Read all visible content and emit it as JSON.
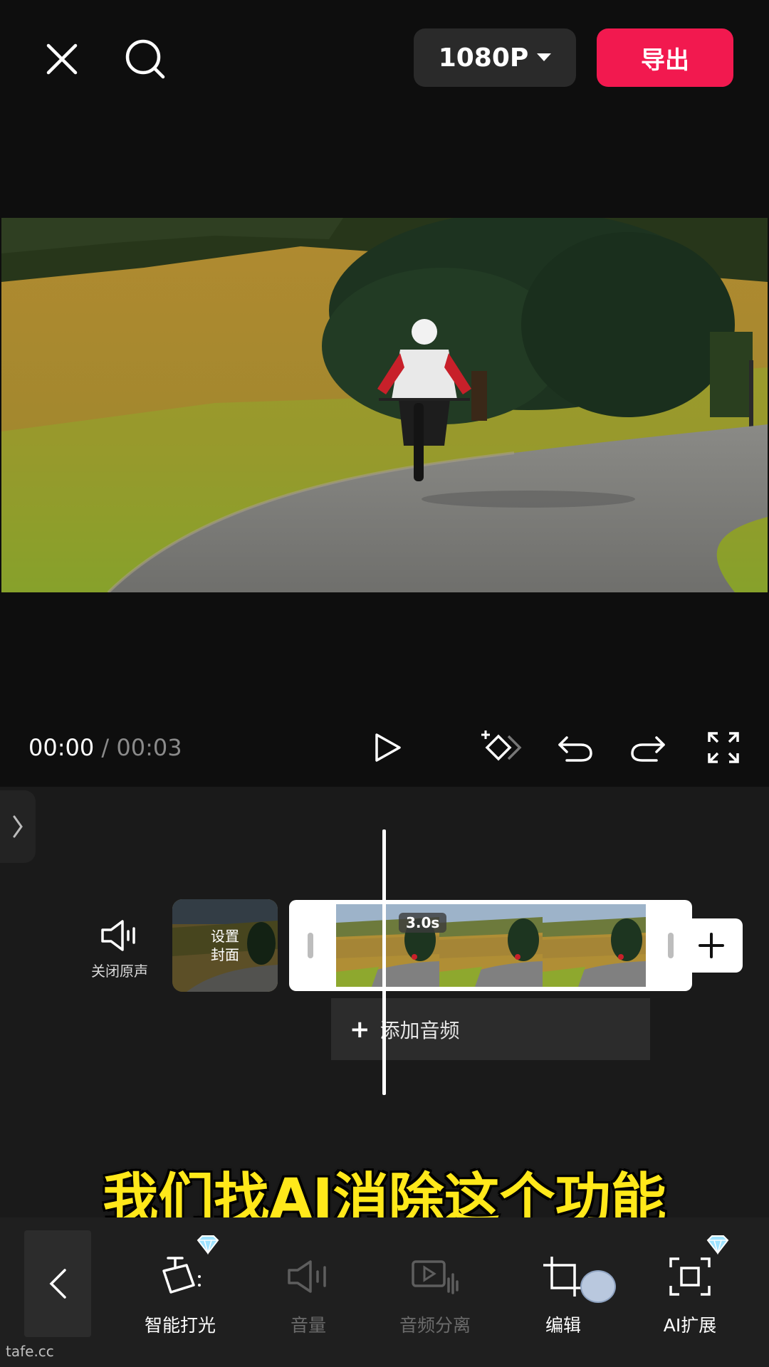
{
  "header": {
    "resolution": "1080P",
    "export_label": "导出"
  },
  "playback": {
    "current_time": "00:00",
    "separator": "/",
    "total_time": "00:03"
  },
  "timeline": {
    "mute_label": "关闭原声",
    "cover_label_line1": "设置",
    "cover_label_line2": "封面",
    "clip_duration": "3.0s",
    "add_audio_label": "添加音频"
  },
  "caption": "我们找AI消除这个功能",
  "toolbar": {
    "items": [
      {
        "label": "智能打光",
        "icon": "smart-light-icon",
        "enabled": true,
        "premium": true
      },
      {
        "label": "音量",
        "icon": "volume-icon",
        "enabled": false,
        "premium": false
      },
      {
        "label": "音频分离",
        "icon": "audio-separate-icon",
        "enabled": false,
        "premium": false
      },
      {
        "label": "编辑",
        "icon": "crop-icon",
        "enabled": true,
        "premium": false
      },
      {
        "label": "AI扩展",
        "icon": "ai-expand-icon",
        "enabled": true,
        "premium": true
      }
    ]
  },
  "watermark": "tafe.cc",
  "colors": {
    "export": "#f2194f",
    "caption": "#ffe81a",
    "premium_gem": "#9fe3ff"
  }
}
